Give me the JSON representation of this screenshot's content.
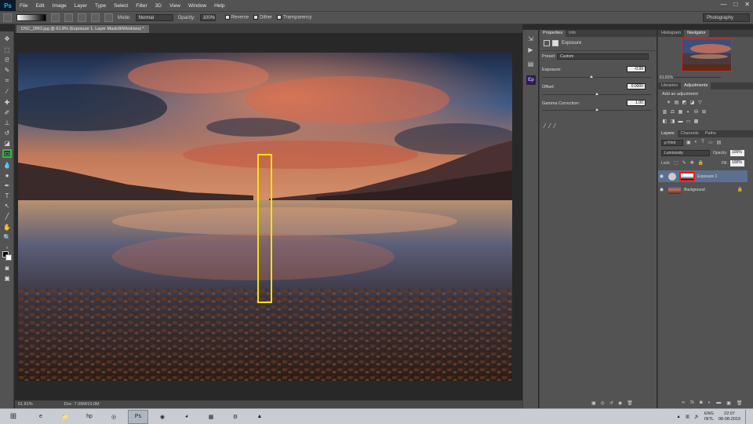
{
  "app": {
    "logo": "Ps",
    "menu": [
      "File",
      "Edit",
      "Image",
      "Layer",
      "Type",
      "Select",
      "Filter",
      "3D",
      "View",
      "Window",
      "Help"
    ],
    "window_controls": [
      "—",
      "□",
      "✕"
    ]
  },
  "options_bar": {
    "mode_label": "Mode:",
    "mode_value": "Normal",
    "opacity_label": "Opacity:",
    "opacity_value": "100%",
    "reverse_label": "Reverse",
    "dither_label": "Dither",
    "transparency_label": "Transparency",
    "workspace": "Photography"
  },
  "document": {
    "tab_title": "DSC_2893.jpg @ 61.8% (Exposure 1, Layer Mask/8/Windows) *",
    "zoom": "61.81%",
    "doc_size": "Doc: 7.09M/10.0M"
  },
  "properties_panel": {
    "tabs": [
      "Properties",
      "Info"
    ],
    "title": "Exposure",
    "preset_label": "Preset:",
    "preset_value": "Custom",
    "exposure_label": "Exposure:",
    "exposure_value": "-0.99",
    "offset_label": "Offset:",
    "offset_value": "0.0000",
    "gamma_label": "Gamma Correction:",
    "gamma_value": "1.00",
    "sliders": {
      "exposure": 0.45,
      "offset": 0.5,
      "gamma": 0.5
    }
  },
  "navigator_panel": {
    "tabs": [
      "Histogram",
      "Navigator"
    ],
    "zoom": "61.81%"
  },
  "adjustments_panel": {
    "tabs": [
      "Libraries",
      "Adjustments"
    ],
    "title": "Add an adjustment",
    "row1": [
      "☀",
      "▤",
      "◩",
      "◪",
      "▽"
    ],
    "row2": [
      "▥",
      "⚖",
      "▦",
      "◐",
      "⛁",
      "⊞"
    ],
    "row3": [
      "◧",
      "◨",
      "▬",
      "▭",
      "▩"
    ]
  },
  "layers_panel": {
    "tabs": [
      "Layers",
      "Channels",
      "Paths"
    ],
    "kind_label": "Kind",
    "blend_mode": "Luminosity",
    "opacity_label": "Opacity:",
    "opacity_value": "100%",
    "lock_label": "Lock:",
    "fill_label": "Fill:",
    "fill_value": "100%",
    "layers": [
      {
        "name": "Exposure 1",
        "selected": true
      },
      {
        "name": "Background",
        "selected": false
      }
    ]
  },
  "taskbar": {
    "apps": [
      "e",
      "📁",
      "hp",
      "◎",
      "Ps",
      "◉",
      "◕",
      "▦",
      "⚙",
      "▲"
    ],
    "language": "ENG",
    "input": "INTL",
    "time": "22:07",
    "date": "08-08-2019"
  },
  "colors": {
    "selection_highlight_green": "#27c437",
    "annotation_yellow": "#f5e400",
    "annotation_red": "#e41c1c"
  }
}
